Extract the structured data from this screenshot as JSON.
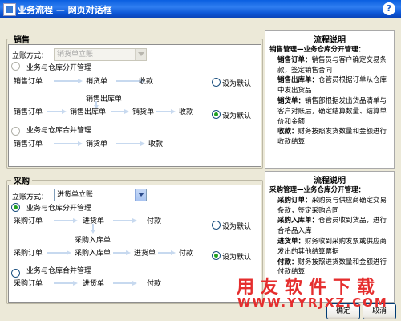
{
  "window": {
    "title": "业务流程 — 网页对话框",
    "help": "?"
  },
  "sales": {
    "group_title": "销售",
    "mode_label": "立账方式：",
    "mode_value": "销货单立账",
    "opt1_label": "业务与仓库分开管理",
    "opt2_label": "业务与仓库合并管理",
    "flow1": {
      "n1": "销售订单",
      "n2": "销货单",
      "n3": "收款",
      "radio_label": "设为默认"
    },
    "flow2": {
      "top": "销售出库单",
      "n1": "销售订单",
      "n2": "销售出库单",
      "n3": "销货单",
      "n4": "收款",
      "radio_label": "设为默认"
    },
    "flow3": {
      "n1": "销售订单",
      "n2": "销货单",
      "n3": "收款"
    }
  },
  "sales_info": {
    "title": "流程说明",
    "heading": "销售管理—业务仓库分开管理：",
    "items": [
      {
        "term": "销售订单：",
        "text": "销售员与客户确定交易条款，签定销售合同"
      },
      {
        "term": "销售出库单：",
        "text": "仓管员根据订单从仓库中发出货品"
      },
      {
        "term": "销货单：",
        "text": "销售部根据发出货品清单与客户对账后，确定结算数量、结算单价和金额"
      },
      {
        "term": "收款：",
        "text": "财务按照发货数量和金额进行收款结算"
      }
    ]
  },
  "purchase": {
    "group_title": "采购",
    "mode_label": "立账方式：",
    "mode_value": "进货单立账",
    "opt1_label": "业务与仓库分开管理",
    "opt2_label": "业务与仓库合并管理",
    "flow1": {
      "n1": "采购订单",
      "n2": "进货单",
      "n3": "付款",
      "radio_label": "设为默认"
    },
    "flow2": {
      "top": "采购入库单",
      "n1": "采购订单",
      "n2": "采购入库单",
      "n3": "进货单",
      "n4": "付款",
      "radio_label": "设为默认"
    },
    "flow3": {
      "n1": "采购订单",
      "n2": "进货单",
      "n3": "付款"
    }
  },
  "purchase_info": {
    "title": "流程说明",
    "heading": "采购管理—业务仓库分开管理：",
    "items": [
      {
        "term": "采购订单：",
        "text": "采购员与供应商确定交易条款，签定采购合同"
      },
      {
        "term": "采购入库单：",
        "text": "仓管员收到货品，进行合格品入库"
      },
      {
        "term": "进货单：",
        "text": "财务收到采购发票或供应商发出的其他结算票据"
      },
      {
        "term": "付款：",
        "text": "财务按照进货数量和金额进行付款结算"
      }
    ]
  },
  "buttons": {
    "ok": "确定",
    "cancel": "取消"
  },
  "watermark": {
    "cn": "用友软件下载",
    "url": "WWW.YYRJXZ.COM"
  }
}
